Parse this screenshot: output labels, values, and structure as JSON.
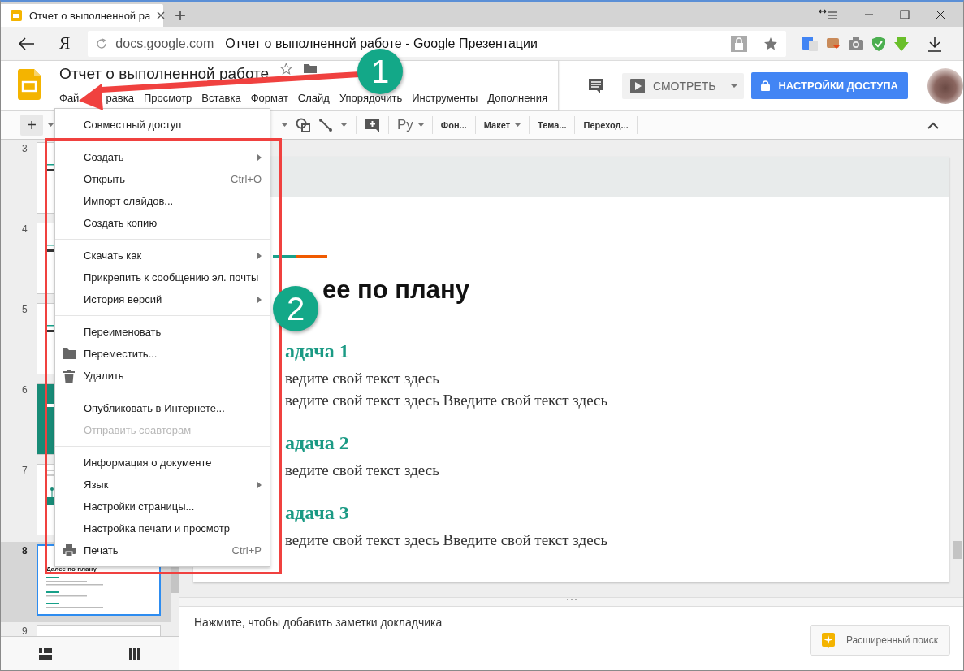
{
  "browser": {
    "logo": "Я",
    "tab_title": "Отчет о выполненной ра",
    "new_tab": "+",
    "url_host": "docs.google.com",
    "url_title": "Отчет о выполненной работе - Google Презентации"
  },
  "doc": {
    "title": "Отчет о выполненной работе",
    "menu": [
      "Фай",
      "равка",
      "Просмотр",
      "Вставка",
      "Формат",
      "Слайд",
      "Упорядочить",
      "Инструменты",
      "Дополнения"
    ],
    "view_button": "СМОТРЕТЬ",
    "share_button": "НАСТРОЙКИ ДОСТУПА"
  },
  "toolbar": {
    "add": "+",
    "input_tools": "Ру",
    "buttons": [
      {
        "label": "Фон...",
        "caret": false
      },
      {
        "label": "Макет",
        "caret": true
      },
      {
        "label": "Тема...",
        "caret": false
      },
      {
        "label": "Переход...",
        "caret": false
      }
    ]
  },
  "file_menu": {
    "sections": [
      [
        {
          "label": "Совместный доступ",
          "kind": "plain",
          "submenu": false,
          "disabled": false
        }
      ],
      [
        {
          "label": "Создать",
          "kind": "plain",
          "submenu": true,
          "disabled": false
        },
        {
          "label": "Открыть",
          "shortcut": "Ctrl+O",
          "kind": "plain",
          "submenu": false,
          "disabled": false
        },
        {
          "label": "Импорт слайдов...",
          "kind": "plain",
          "submenu": false,
          "disabled": false
        },
        {
          "label": "Создать копию",
          "kind": "plain",
          "submenu": false,
          "disabled": false
        }
      ],
      [
        {
          "label": "Скачать как",
          "kind": "plain",
          "submenu": true,
          "disabled": false
        },
        {
          "label": "Прикрепить к сообщению эл. почты",
          "kind": "plain",
          "submenu": false,
          "disabled": false
        },
        {
          "label": "История версий",
          "kind": "plain",
          "submenu": true,
          "disabled": false
        }
      ],
      [
        {
          "label": "Переименовать",
          "kind": "plain",
          "submenu": false,
          "disabled": false
        },
        {
          "label": "Переместить...",
          "kind": "folder",
          "submenu": false,
          "disabled": false
        },
        {
          "label": "Удалить",
          "kind": "trash",
          "submenu": false,
          "disabled": false
        }
      ],
      [
        {
          "label": "Опубликовать в Интернете...",
          "kind": "plain",
          "submenu": false,
          "disabled": false
        },
        {
          "label": "Отправить соавторам",
          "kind": "plain",
          "submenu": false,
          "disabled": true
        }
      ],
      [
        {
          "label": "Информация о документе",
          "kind": "plain",
          "submenu": false,
          "disabled": false
        },
        {
          "label": "Язык",
          "kind": "plain",
          "submenu": true,
          "disabled": false
        },
        {
          "label": "Настройки страницы...",
          "kind": "plain",
          "submenu": false,
          "disabled": false
        },
        {
          "label": "Настройка печати и просмотр",
          "kind": "plain",
          "submenu": false,
          "disabled": false
        },
        {
          "label": "Печать",
          "shortcut": "Ctrl+P",
          "kind": "printer",
          "submenu": false,
          "disabled": false
        }
      ]
    ]
  },
  "slides": [
    {
      "number": "3",
      "selected": false,
      "kind": "text"
    },
    {
      "number": "4",
      "selected": false,
      "kind": "text"
    },
    {
      "number": "5",
      "selected": false,
      "kind": "text"
    },
    {
      "number": "6",
      "selected": false,
      "kind": "teal"
    },
    {
      "number": "7",
      "selected": false,
      "kind": "diagram"
    },
    {
      "number": "8",
      "selected": true,
      "kind": "list",
      "title": "Далее по плану"
    },
    {
      "number": "9",
      "selected": false,
      "kind": "blank"
    }
  ],
  "slide": {
    "title": "ее по плану",
    "blocks": [
      {
        "heading": "адача 1",
        "lines": [
          "ведите свой текст здесь",
          "ведите свой текст здесь Введите свой текст здесь"
        ]
      },
      {
        "heading": "адача 2",
        "lines": [
          "ведите свой текст здесь"
        ]
      },
      {
        "heading": "адача 3",
        "lines": [
          "ведите свой текст здесь Введите свой текст здесь"
        ]
      }
    ]
  },
  "notes": {
    "placeholder": "Нажмите, чтобы добавить заметки докладчика"
  },
  "explore_button": "Расширенный поиск",
  "annotations": [
    {
      "label": "1"
    },
    {
      "label": "2"
    }
  ]
}
